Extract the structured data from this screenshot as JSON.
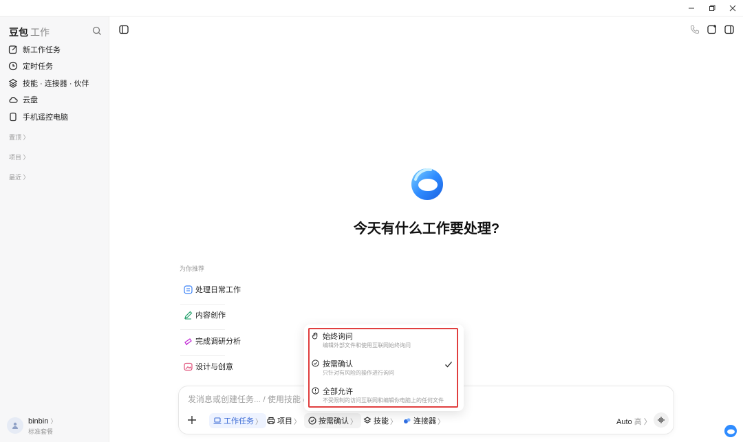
{
  "brand": {
    "name": "豆包",
    "suffix": "工作"
  },
  "sidebar": {
    "items": [
      {
        "label": "新工作任务",
        "icon": "edit-icon"
      },
      {
        "label": "定时任务",
        "icon": "clock-icon"
      },
      {
        "label": "技能 · 连接器 · 伙伴",
        "icon": "layers-icon"
      },
      {
        "label": "云盘",
        "icon": "cloud-icon"
      },
      {
        "label": "手机遥控电脑",
        "icon": "phone-icon"
      }
    ],
    "sections": [
      "置顶",
      "项目",
      "最近"
    ]
  },
  "user": {
    "name": "binbin",
    "plan": "标准套餐"
  },
  "main": {
    "headline": "今天有什么工作要处理?",
    "recommend_title": "为你推荐",
    "recommendations": [
      {
        "label": "处理日常工作",
        "icon": "list-icon",
        "color": "#3b82f6"
      },
      {
        "label": "内容创作",
        "icon": "pen-icon",
        "color": "#22a06b"
      },
      {
        "label": "完成调研分析",
        "icon": "telescope-icon",
        "color": "#c026d3"
      },
      {
        "label": "设计与创意",
        "icon": "image-icon",
        "color": "#e0507a"
      }
    ]
  },
  "composer": {
    "placeholder": "发消息或创建任务... / 使用技能 @",
    "chips": [
      {
        "label": "工作任务",
        "icon": "laptop-icon"
      },
      {
        "label": "项目",
        "icon": "printer-icon"
      },
      {
        "label": "按需确认",
        "icon": "shield-check-icon"
      },
      {
        "label": "技能",
        "icon": "layers-icon"
      },
      {
        "label": "连接器",
        "icon": "connector-icon"
      }
    ],
    "mode": "Auto",
    "quality": "高"
  },
  "permission_menu": {
    "options": [
      {
        "title": "始终询问",
        "desc": "编辑外部文件和使用互联网始终询问",
        "icon": "hand-icon",
        "selected": false
      },
      {
        "title": "按需确认",
        "desc": "只针对有风险的操作进行询问",
        "icon": "shield-check-icon",
        "selected": true
      },
      {
        "title": "全部允许",
        "desc": "不受限制的访问互联网和编辑你电脑上的任何文件",
        "icon": "alert-circle-icon",
        "selected": false
      }
    ]
  },
  "colors": {
    "accent": "#3b6bd6",
    "highlight_border": "#e03e3e"
  }
}
